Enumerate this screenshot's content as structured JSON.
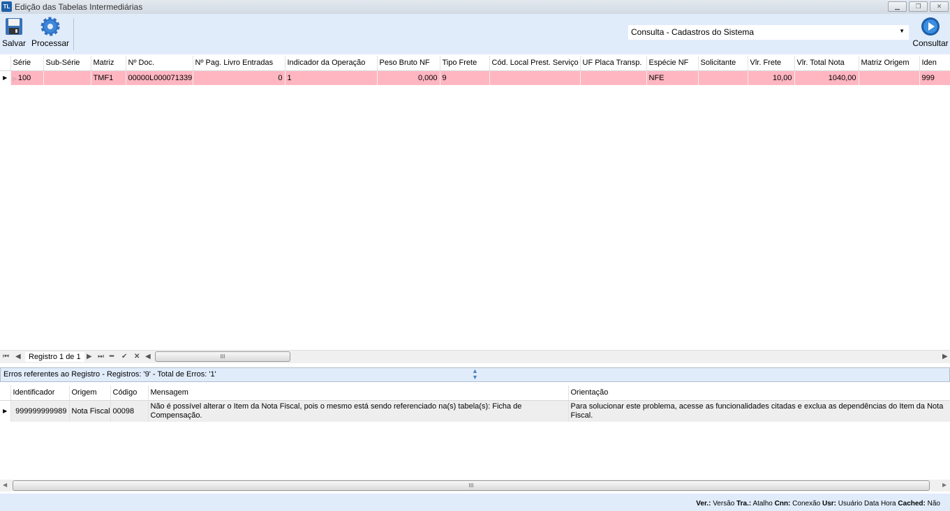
{
  "window": {
    "title": "Edição das Tabelas Intermediárias",
    "logo": "TL"
  },
  "toolbar": {
    "save_label": "Salvar",
    "process_label": "Processar",
    "query_label": "Consultar",
    "query_select": "Consulta - Cadastros do Sistema"
  },
  "main_grid": {
    "columns": [
      "Série",
      "Sub-Série",
      "Matriz",
      "Nº Doc.",
      "Nº Pag. Livro Entradas",
      "Indicador da Operação",
      "Peso Bruto NF",
      "Tipo Frete",
      "Cód. Local Prest. Serviço",
      "UF Placa Transp.",
      "Espécie NF",
      "Solicitante",
      "Vlr. Frete",
      "Vlr. Total Nota",
      "Matriz Origem",
      "Iden"
    ],
    "rows": [
      [
        "100",
        "",
        "TMF1",
        "00000L000071339",
        "0",
        "1",
        "0,000",
        "9",
        "",
        "",
        "NFE",
        "",
        "10,00",
        "1040,00",
        "",
        "999"
      ]
    ]
  },
  "navigator": {
    "record_label": "Registro 1 de 1"
  },
  "errors": {
    "header": "Erros referentes ao Registro - Registros: '9' - Total de Erros: '1'",
    "columns": [
      "Identificador",
      "Origem",
      "Código",
      "Mensagem",
      "Orientação"
    ],
    "rows": [
      [
        "999999999989",
        "Nota Fiscal",
        "00098",
        "Não é possível alterar o Item da Nota Fiscal, pois o mesmo está sendo referenciado na(s) tabela(s): Ficha de Compensação.",
        "Para solucionar este problema, acesse as funcionalidades citadas e exclua as dependências do Item da Nota Fiscal."
      ]
    ]
  },
  "status": {
    "ver_label": "Ver.:",
    "ver": "Versão",
    "tra_label": "Tra.:",
    "tra": "Atalho",
    "cnn_label": "Cnn:",
    "cnn": "Conexão",
    "usr_label": "Usr:",
    "usr": "Usuário",
    "date": "Data",
    "time": "Hora",
    "cached_label": "Cached:",
    "cached": "Não"
  }
}
